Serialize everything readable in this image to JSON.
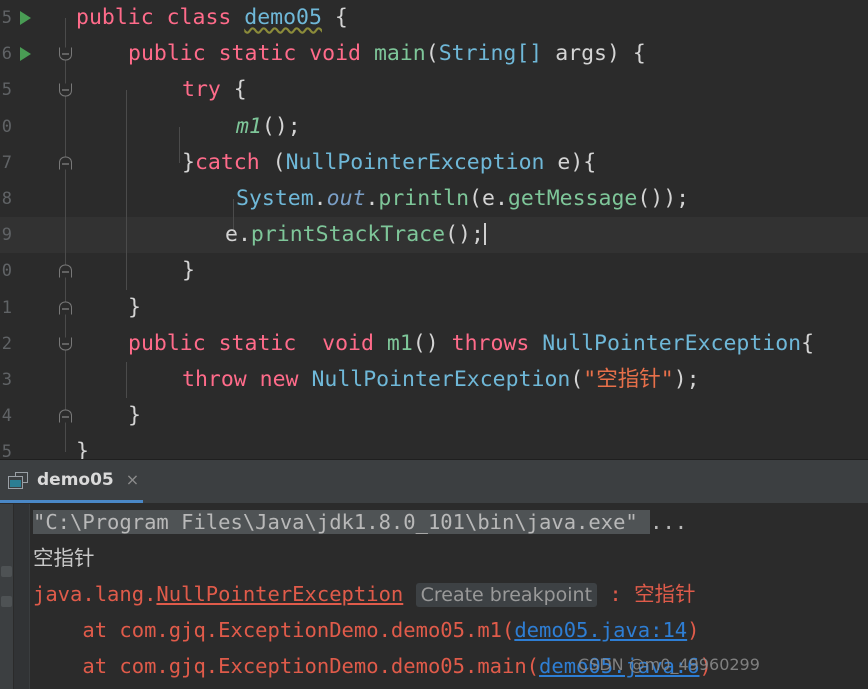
{
  "editor": {
    "language": "java",
    "theme": "darcula",
    "background": "#2b2b2b",
    "current_line_background": "#323232",
    "caret_line_index": 8,
    "lines": [
      {
        "number": "5",
        "run_marker": true,
        "fold": "none",
        "text": "public class demo05 {",
        "indent": 0
      },
      {
        "number": "6",
        "run_marker": true,
        "fold": "start",
        "text": "public static void main(String[] args) {",
        "indent": 1
      },
      {
        "number": "5",
        "run_marker": false,
        "fold": "start",
        "text": "try {",
        "indent": 2
      },
      {
        "number": "0",
        "run_marker": false,
        "fold": "none",
        "text": "m1();",
        "indent": 3
      },
      {
        "number": "7",
        "run_marker": false,
        "fold": "end",
        "text": "}catch (NullPointerException e){",
        "indent": 2
      },
      {
        "number": "8",
        "run_marker": false,
        "fold": "none",
        "text": "System.out.println(e.getMessage());",
        "indent": 3
      },
      {
        "number": "9",
        "run_marker": false,
        "fold": "none",
        "text": "e.printStackTrace();",
        "indent": 3,
        "caret": true
      },
      {
        "number": "0",
        "run_marker": false,
        "fold": "end",
        "text": "}",
        "indent": 2
      },
      {
        "number": "1",
        "run_marker": false,
        "fold": "end",
        "text": "}",
        "indent": 1
      },
      {
        "number": "2",
        "run_marker": false,
        "fold": "start",
        "text": "public static  void m1() throws NullPointerException{",
        "indent": 1
      },
      {
        "number": "3",
        "run_marker": false,
        "fold": "none",
        "text": "throw new NullPointerException(\"空指针\");",
        "indent": 2
      },
      {
        "number": "4",
        "run_marker": false,
        "fold": "end",
        "text": "}",
        "indent": 1
      },
      {
        "number": "5",
        "run_marker": false,
        "fold": "none",
        "text": "}",
        "indent": 0
      }
    ],
    "tokens": {
      "keyword_public": "public",
      "keyword_class": "class",
      "keyword_static": "static",
      "keyword_void": "void",
      "keyword_try": "try",
      "keyword_catch": "catch",
      "keyword_throw": "throw",
      "keyword_new": "new",
      "keyword_throws": "throws",
      "class_name": "demo05",
      "method_main": "main",
      "type_string": "String[]",
      "param_args": "args",
      "method_m1": "m1",
      "exception_npe": "NullPointerException",
      "var_e": "e",
      "system": "System",
      "out": "out",
      "println": "println",
      "get_message": "getMessage",
      "print_stack_trace": "printStackTrace",
      "string_literal": "\"空指针\""
    },
    "colors": {
      "keyword": "#ff6b8a",
      "class": "#6fb8d8",
      "method": "#7ec699",
      "field": "#9876aa",
      "string": "#e8704a",
      "plain": "#d4d4d4",
      "line_number": "#606366",
      "run_marker_green": "#499C54"
    }
  },
  "console": {
    "tab": {
      "label": "demo05",
      "close_label": "×",
      "icon": "console-window-icon",
      "active_underline_color": "#4a88c7"
    },
    "output": [
      {
        "kind": "command",
        "text_highlight": "\"C:\\Program Files\\Java\\jdk1.8.0_101\\bin\\java.exe\" ",
        "text_plain": "..."
      },
      {
        "kind": "stdout",
        "text": "空指针"
      },
      {
        "kind": "exception-header",
        "prefix": "java.lang.",
        "exception": "NullPointerException",
        "chip": "Create breakpoint",
        "separator": " : ",
        "message": "空指针"
      },
      {
        "kind": "stack-frame",
        "text": "    at com.gjq.ExceptionDemo.demo05.m1(",
        "link": "demo05.java:14",
        "suffix": ")"
      },
      {
        "kind": "stack-frame",
        "text": "    at com.gjq.ExceptionDemo.demo05.main(",
        "link": "demo05.java:6",
        "suffix": ")"
      }
    ],
    "colors": {
      "error": "#e05b4a",
      "link": "#2e7ed4",
      "command_highlight_bg": "#4f5355"
    }
  },
  "watermark": {
    "text": "CSDN @m0_49960299"
  }
}
